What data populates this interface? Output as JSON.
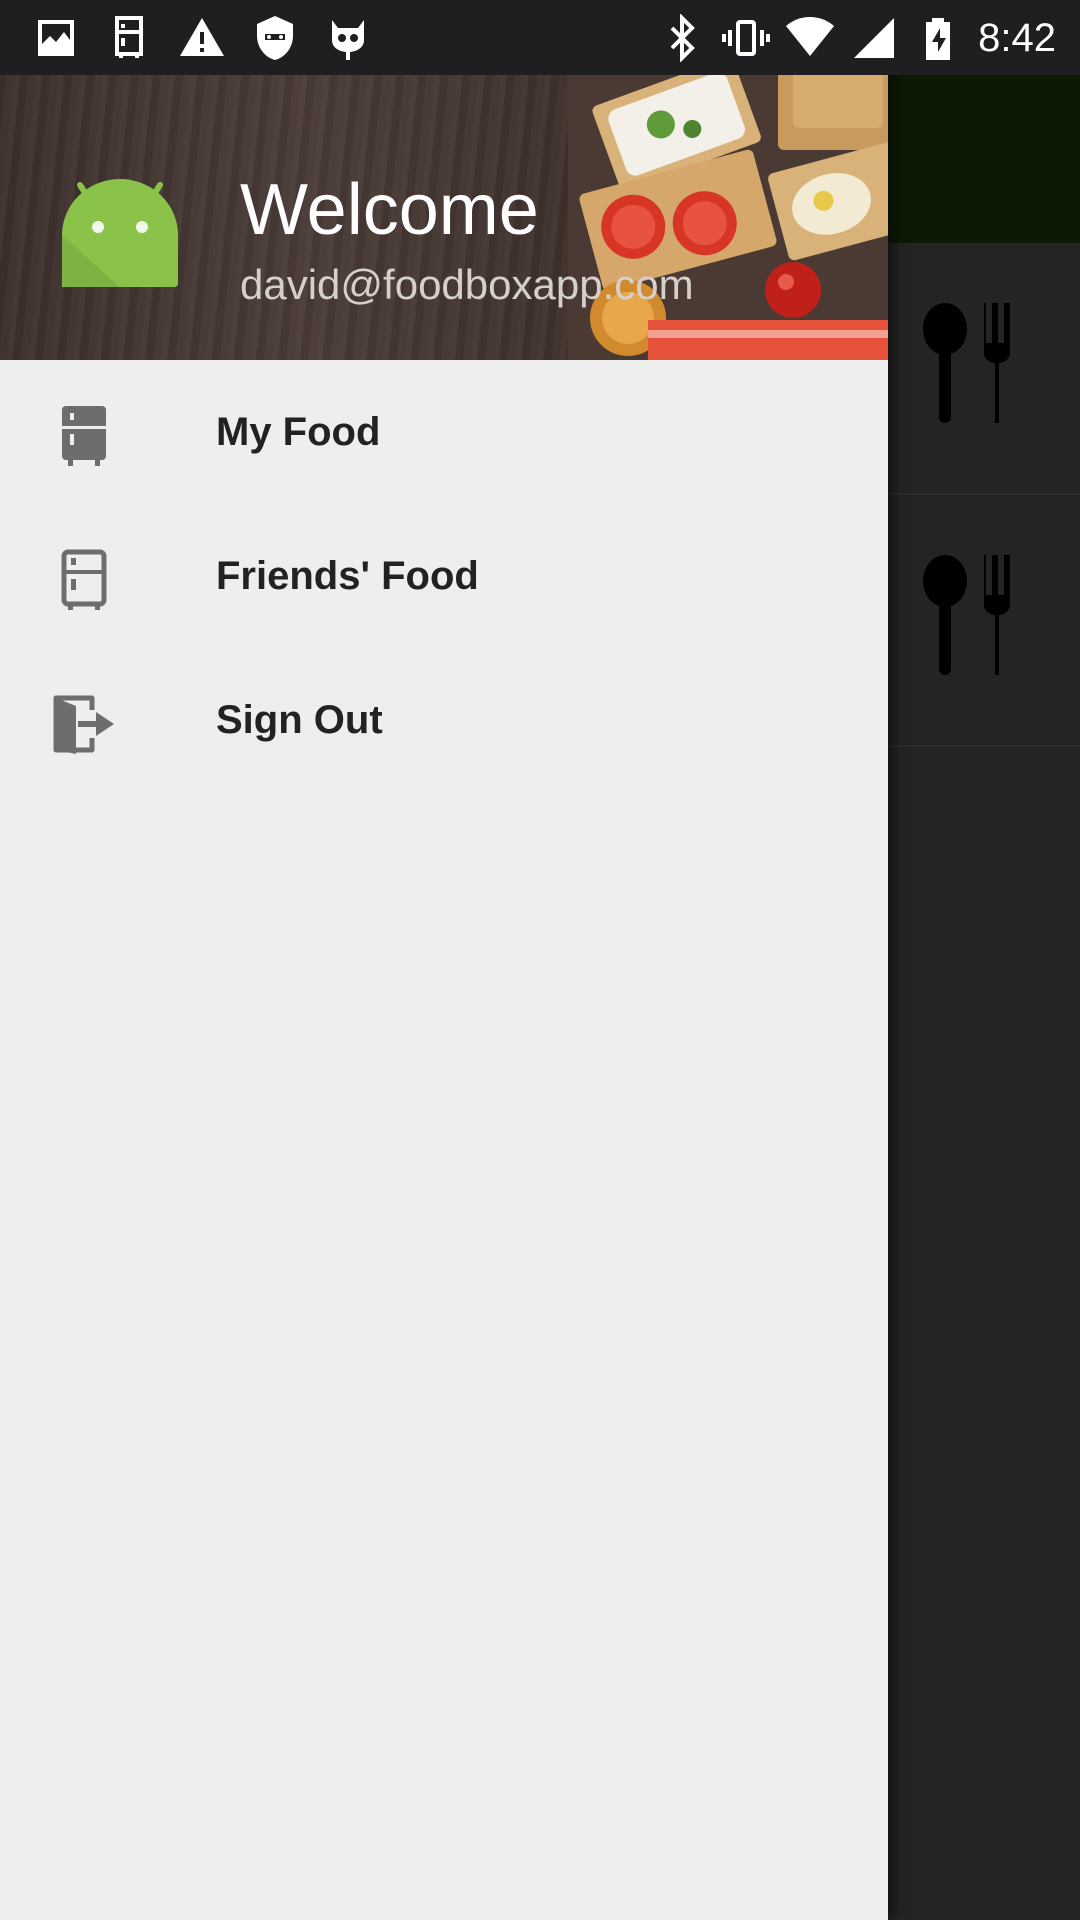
{
  "status_bar": {
    "time": "8:42",
    "left_icons": [
      "image-icon",
      "fridge-icon",
      "warning-icon",
      "shield-icon",
      "cyanogen-icon"
    ],
    "right_icons": [
      "bluetooth-icon",
      "vibrate-icon",
      "wifi-icon",
      "signal-icon",
      "battery-charging-icon"
    ]
  },
  "drawer": {
    "header": {
      "title": "Welcome",
      "email": "david@foodboxapp.com",
      "avatar": "android-icon"
    },
    "items": [
      {
        "label": "My Food",
        "icon": "fridge-filled-icon"
      },
      {
        "label": "Friends' Food",
        "icon": "fridge-outline-icon"
      },
      {
        "label": "Sign Out",
        "icon": "exit-icon"
      }
    ]
  },
  "background_list": {
    "row_icon": "cutlery-icon"
  },
  "colors": {
    "drawer_bg": "#eeeeee",
    "android_green": "#8bc34a",
    "toolbar": "#0c1a05",
    "scrim_bg": "#242424"
  }
}
